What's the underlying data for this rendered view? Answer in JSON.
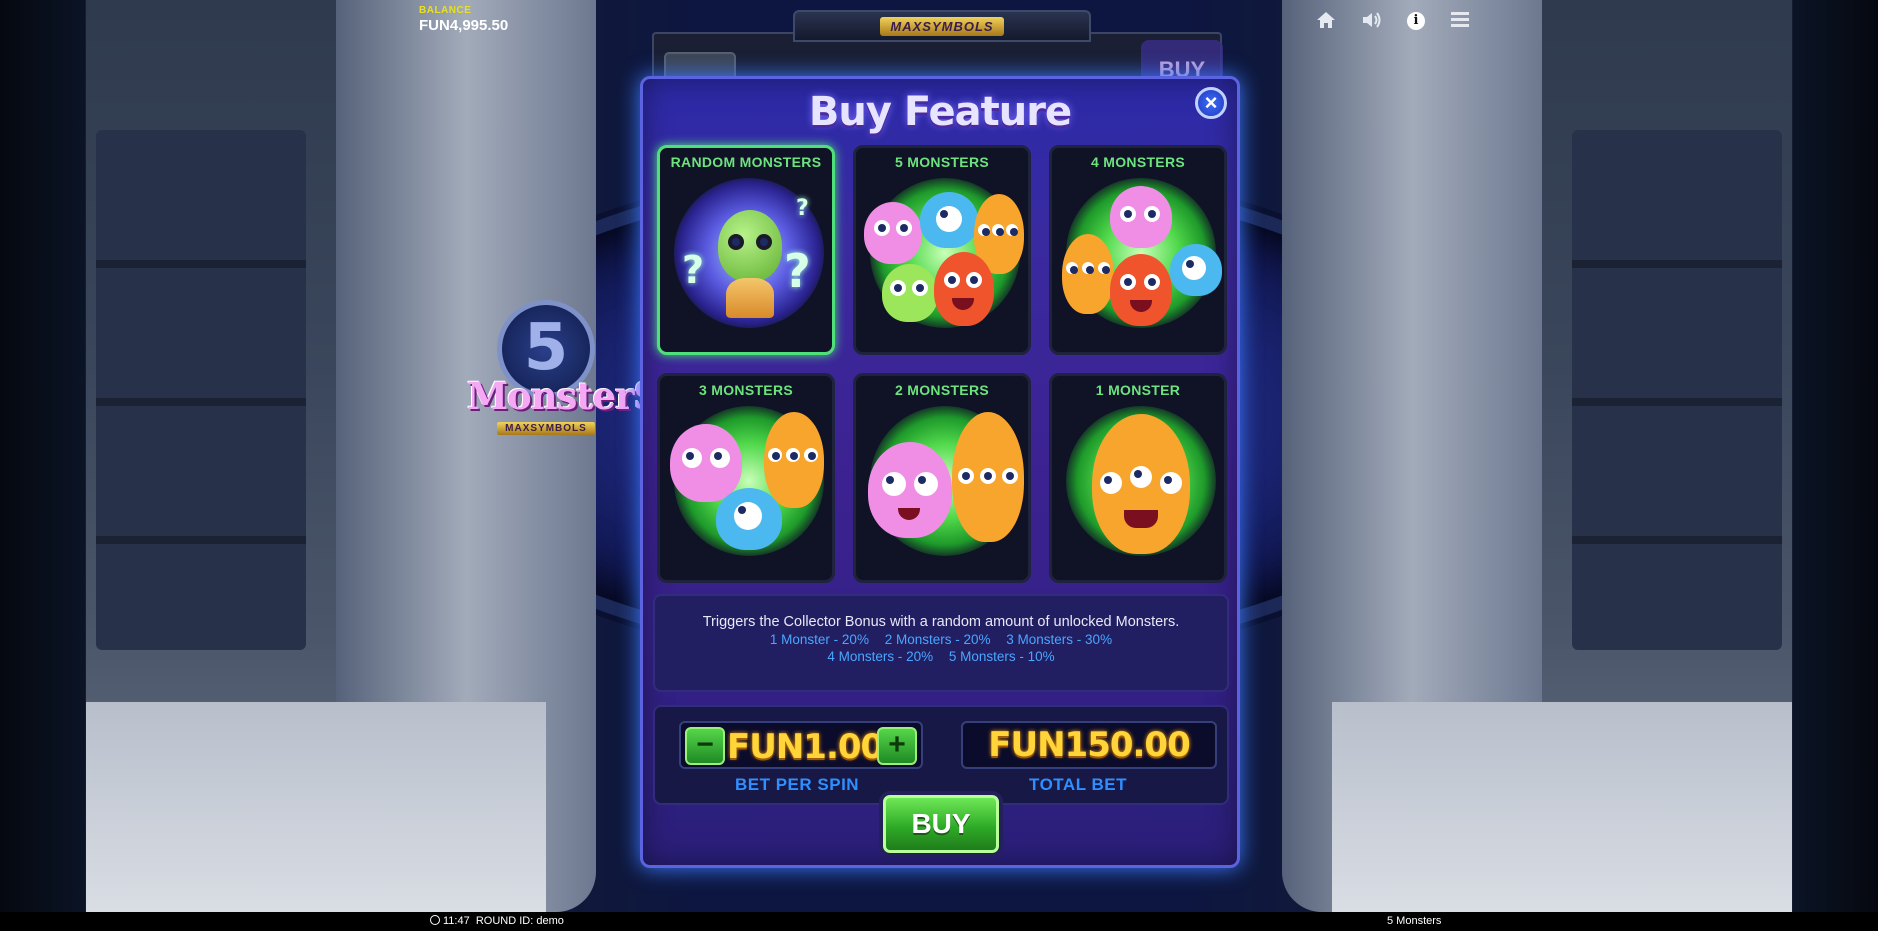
{
  "hud": {
    "balance_label": "BALANCE",
    "balance_value": "FUN4,995.50",
    "top_logo": "MAXSYMBOLS",
    "top_buy": "BUY",
    "icons": [
      "home-icon",
      "speaker-icon",
      "info-icon",
      "menu-icon"
    ]
  },
  "game_logo": {
    "number": "5",
    "name": "MonsterS",
    "sub": "MAXSYMBOLS"
  },
  "modal": {
    "title": "Buy Feature",
    "close_label": "×",
    "options": [
      {
        "label": "RANDOM MONSTERS",
        "selected": true
      },
      {
        "label": "5 MONSTERS",
        "selected": false
      },
      {
        "label": "4 MONSTERS",
        "selected": false
      },
      {
        "label": "3 MONSTERS",
        "selected": false
      },
      {
        "label": "2 MONSTERS",
        "selected": false
      },
      {
        "label": "1 MONSTER",
        "selected": false
      }
    ],
    "description": "Triggers the Collector Bonus with a random amount of unlocked Monsters.",
    "odds": [
      "1 Monster - 20%",
      "2 Monsters - 20%",
      "3 Monsters - 30%",
      "4 Monsters - 20%",
      "5 Monsters - 10%"
    ],
    "bet_minus": "−",
    "bet_plus": "+",
    "bet_value": "FUN1.00",
    "bet_label": "BET PER SPIN",
    "total_value": "FUN150.00",
    "total_label": "TOTAL BET",
    "buy_label": "BUY"
  },
  "footer": {
    "time": "11:47",
    "round": "ROUND ID: demo",
    "game_name": "5 Monsters"
  },
  "colors": {
    "accent_green": "#6de37e",
    "odds_blue": "#4aa6ff",
    "gold": "#ffd53a",
    "modal_border": "#5c63e0"
  }
}
